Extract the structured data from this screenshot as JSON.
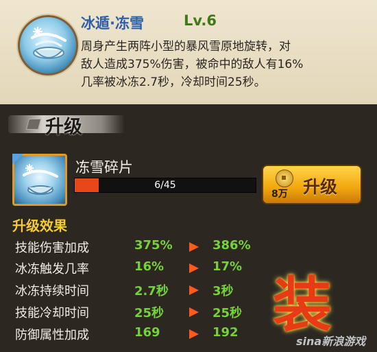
{
  "skill": {
    "title": "冰遁·冻雪",
    "level": "Lv.6",
    "description_lines": [
      "周身产生两阵小型的暴风雪原地旋转，对",
      "敌人造成375%伤害，被命中的敌人有16%",
      "几率被冰冻2.7秒，冷却时间25秒。"
    ],
    "icon": "ice-snow-bowl-icon"
  },
  "upgrade_section": {
    "label": "升级"
  },
  "material": {
    "name": "冻雪碎片",
    "progress_text": "6/45",
    "progress_fraction": 0.133,
    "icon": "ice-fragment-icon"
  },
  "upgrade_button": {
    "cost": "8万",
    "label": "升级",
    "coin_icon": "copper-coin-icon"
  },
  "effects": {
    "title": "升级效果",
    "rows": [
      {
        "name": "技能伤害加成",
        "old": "375%",
        "new": "386%"
      },
      {
        "name": "冰冻触发几率",
        "old": "16%",
        "new": "17%"
      },
      {
        "name": "冰冻持续时间",
        "old": "2.7秒",
        "new": "3秒"
      },
      {
        "name": "技能冷却时间",
        "old": "25秒",
        "new": "25秒"
      },
      {
        "name": "防御属性加成",
        "old": "169",
        "new": "192"
      }
    ]
  },
  "decoration": {
    "glyph": "装",
    "site_mark": "sina新浪游戏"
  },
  "colors": {
    "title_blue": "#2e5fa8",
    "level_green": "#3f7a17",
    "value_green": "#76d23b",
    "arrow_orange": "#ff5a1e",
    "effects_title_yellow": "#f4cb31",
    "progress_fill": "#e8471a"
  }
}
